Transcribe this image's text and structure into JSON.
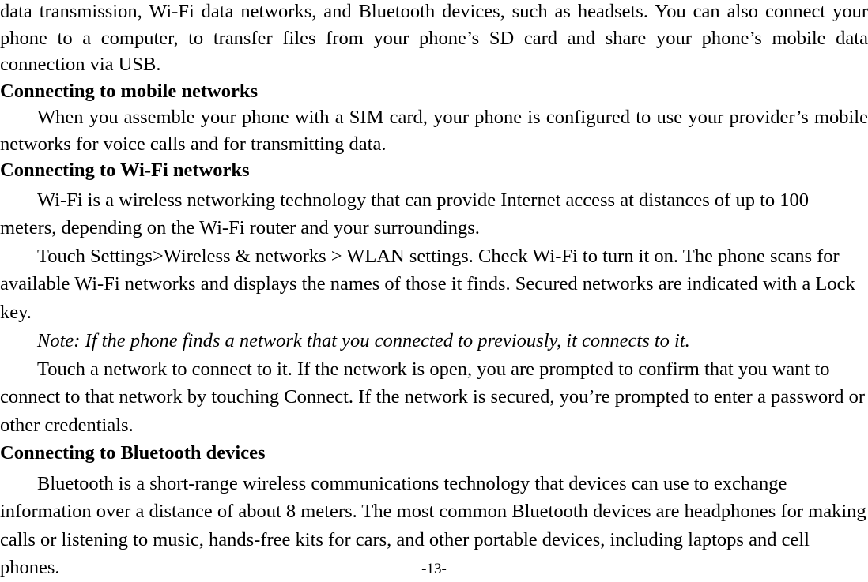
{
  "document": {
    "page_number_label": "-13-",
    "blocks": [
      {
        "id": "intro_paragraph",
        "type": "paragraph",
        "align": "justify",
        "text": "data transmission, Wi-Fi data networks, and Bluetooth devices, such as headsets. You can also connect your phone to a computer, to transfer files from your phone’s SD card and share your phone’s mobile data connection via USB."
      },
      {
        "id": "heading_mobile_networks",
        "type": "heading",
        "text": "Connecting to mobile networks"
      },
      {
        "id": "mobile_networks_paragraph",
        "type": "paragraph",
        "align": "justify",
        "text": "When you assemble your phone with a SIM card, your phone is configured to use your provider’s mobile networks for voice calls and for transmitting data."
      },
      {
        "id": "heading_wifi_networks",
        "type": "heading",
        "text": "Connecting to Wi-Fi networks"
      },
      {
        "id": "wifi_paragraph_1",
        "type": "paragraph",
        "align": "left",
        "text": "Wi-Fi is a wireless networking technology that can provide Internet access at distances of up to 100 meters, depending on the Wi-Fi router and your surroundings."
      },
      {
        "id": "wifi_paragraph_2",
        "type": "paragraph",
        "align": "left",
        "text": "Touch Settings>Wireless & networks > WLAN settings. Check Wi-Fi to turn it on. The phone scans for available Wi-Fi networks and displays the names of those it finds. Secured networks are indicated with a Lock key."
      },
      {
        "id": "wifi_note",
        "type": "note",
        "text": "Note: If the phone finds a network that you connected to previously, it connects to it."
      },
      {
        "id": "wifi_paragraph_3",
        "type": "paragraph",
        "align": "left",
        "text": "Touch a network to connect to it. If the network is open, you are prompted to confirm that you want to connect to that network by touching Connect. If the network is secured, you’re prompted to enter a password or other credentials."
      },
      {
        "id": "heading_bluetooth_devices",
        "type": "heading",
        "text": "Connecting to Bluetooth devices"
      },
      {
        "id": "bluetooth_paragraph",
        "type": "paragraph",
        "align": "left",
        "text": "Bluetooth is a short-range wireless communications technology that devices can use to exchange information over a distance of about 8 meters. The most common Bluetooth devices are headphones for making calls or listening to music, hands-free kits for cars, and other portable devices, including laptops and cell phones."
      }
    ]
  }
}
